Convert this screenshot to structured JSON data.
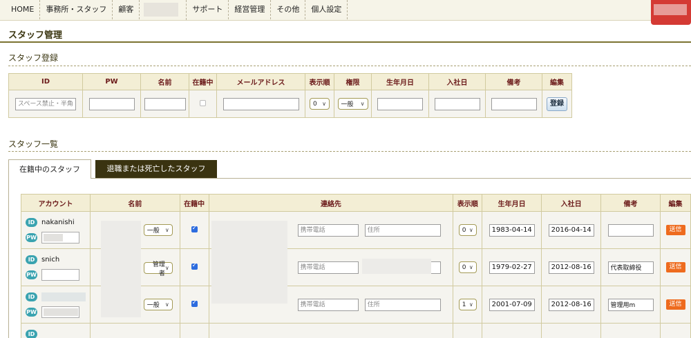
{
  "nav": {
    "items": [
      "HOME",
      "事務所・スタッフ",
      "顧客",
      "サポート",
      "経営管理",
      "その他",
      "個人設定"
    ]
  },
  "page_title": "スタッフ管理",
  "register": {
    "heading": "スタッフ登録",
    "columns": [
      "ID",
      "PW",
      "名前",
      "在籍中",
      "メールアドレス",
      "表示順",
      "権限",
      "生年月日",
      "入社日",
      "備考",
      "編集"
    ],
    "id_placeholder": "スペース禁止・半角英",
    "order_value": "0",
    "role_value": "一般",
    "submit_label": "登録"
  },
  "list": {
    "heading": "スタッフ一覧",
    "tabs": {
      "active": "在籍中のスタッフ",
      "inactive": "退職または死亡したスタッフ"
    },
    "columns": [
      "アカウント",
      "名前",
      "在籍中",
      "連絡先",
      "表示順",
      "生年月日",
      "入社日",
      "備考",
      "編集"
    ],
    "id_pill": "ID",
    "pw_pill": "PW",
    "mobile_placeholder": "携帯電話",
    "address_placeholder": "住所",
    "send_label": "送信",
    "rows": [
      {
        "account": "nakanishi",
        "role": "一般",
        "order": "0",
        "birth": "1983-04-14",
        "joined": "2016-04-14",
        "note": ""
      },
      {
        "account": "snich",
        "role": "管理者",
        "order": "0",
        "birth": "1979-02-27",
        "joined": "2012-08-16",
        "note": "代表取締役"
      },
      {
        "account": "",
        "role": "一般",
        "order": "1",
        "birth": "2001-07-09",
        "joined": "2012-08-16",
        "note": "管理用m"
      }
    ]
  }
}
